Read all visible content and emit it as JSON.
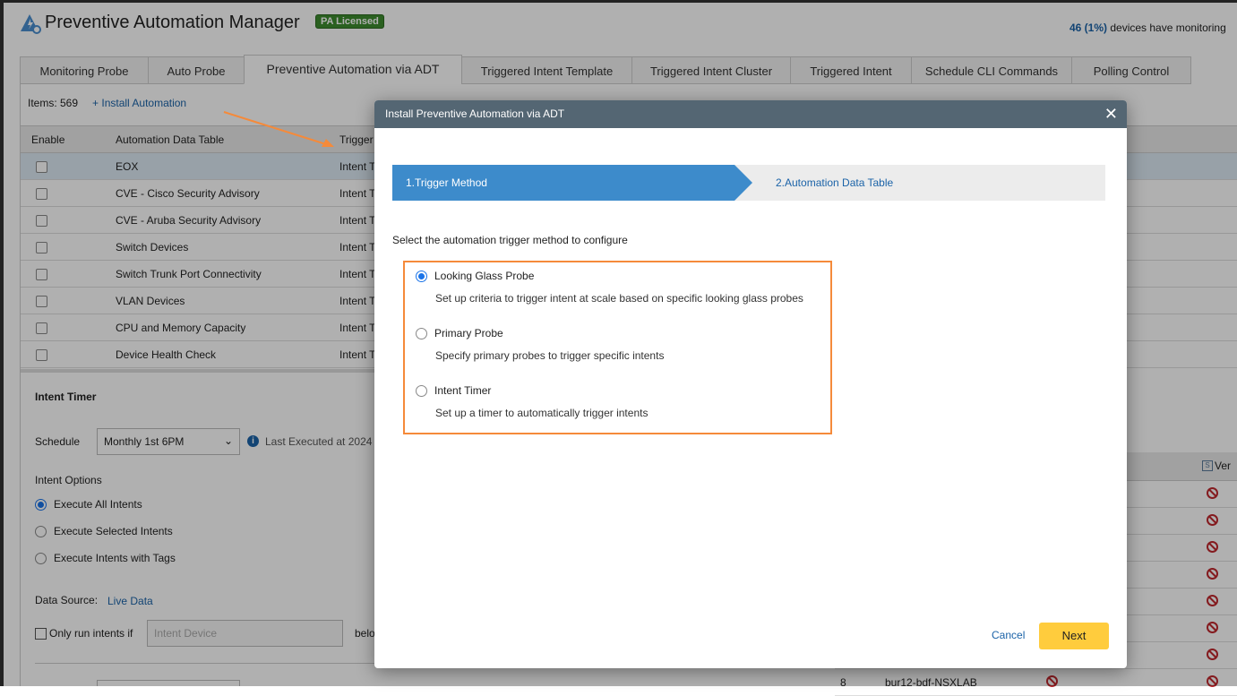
{
  "header": {
    "title": "Preventive Automation Manager",
    "badge": "PA Licensed",
    "monitor_count": "46 (1%)",
    "monitor_text": " devices have monitoring"
  },
  "tabs": [
    "Monitoring Probe",
    "Auto Probe",
    "Preventive Automation via ADT",
    "Triggered Intent Template",
    "Triggered Intent Cluster",
    "Triggered Intent",
    "Schedule CLI Commands",
    "Polling Control"
  ],
  "toolbar": {
    "items": "Items: 569",
    "install": "+ Install Automation"
  },
  "table": {
    "headers": [
      "Enable",
      "Automation Data Table",
      "Trigger"
    ],
    "rows": [
      {
        "name": "EOX",
        "trigger": "Intent T"
      },
      {
        "name": "CVE - Cisco Security Advisory",
        "trigger": "Intent T"
      },
      {
        "name": "CVE - Aruba Security Advisory",
        "trigger": "Intent T"
      },
      {
        "name": "Switch Devices",
        "trigger": "Intent T"
      },
      {
        "name": "Switch Trunk Port Connectivity",
        "trigger": "Intent T"
      },
      {
        "name": "VLAN Devices",
        "trigger": "Intent T"
      },
      {
        "name": "CPU and Memory Capacity",
        "trigger": "Intent T"
      },
      {
        "name": "Device Health Check",
        "trigger": "Intent T"
      }
    ]
  },
  "timer": {
    "title": "Intent Timer",
    "schedule_label": "Schedule",
    "schedule_value": "Monthly 1st 6PM",
    "last_executed": "Last Executed at 2024",
    "options_label": "Intent Options",
    "options": [
      "Execute All Intents",
      "Execute Selected Intents",
      "Execute Intents with Tags"
    ],
    "data_source_label": "Data Source:",
    "data_source_value": "Live Data",
    "only_run": "Only run intents if",
    "intent_device_placeholder": "Intent Device",
    "below": "belo"
  },
  "right_table": {
    "header": "Ver",
    "row_num": "8",
    "row_device": "bur12-bdf-NSXLAB"
  },
  "modal": {
    "title": "Install Preventive Automation via ADT",
    "step1": "1.Trigger Method",
    "step2": "2.Automation Data Table",
    "prompt": "Select the automation trigger method to configure",
    "options": [
      {
        "label": "Looking Glass Probe",
        "desc": "Set up criteria to trigger intent at scale based on specific looking glass probes",
        "selected": true
      },
      {
        "label": "Primary Probe",
        "desc": "Specify primary probes to trigger specific intents",
        "selected": false
      },
      {
        "label": "Intent Timer",
        "desc": "Set up a timer to automatically trigger intents",
        "selected": false
      }
    ],
    "cancel": "Cancel",
    "next": "Next"
  }
}
